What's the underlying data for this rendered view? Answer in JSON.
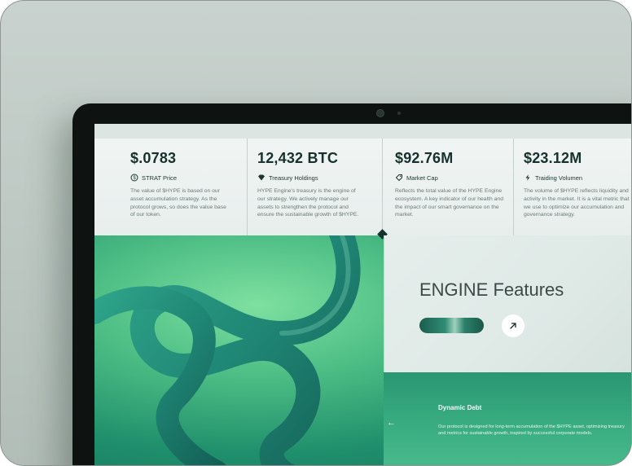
{
  "stats": [
    {
      "value": "$.0783",
      "label": "STRAT Price",
      "icon": "coin-icon",
      "desc": "The value of $HYPE is based on our asset accumulation strategy. As the protocol grows, so does the value base of our token."
    },
    {
      "value": "12,432 BTC",
      "label": "Treasury Holdings",
      "icon": "diamond-icon",
      "desc": "HYPE Engine's treasury is the engine of our strategy. We actively manage our assets to strengthen the protocol and ensure the sustainable growth of $HYPE."
    },
    {
      "value": "$92.76M",
      "label": "Market Cap",
      "icon": "tag-icon",
      "desc": "Reflects the total value of the HYPE Engine ecosystem. A key indicator of our health and the impact of our smart governance on the market."
    },
    {
      "value": "$23.12M",
      "label": "Traiding Volumen",
      "icon": "bolt-icon",
      "desc": "The volume of $HYPE reflects liquidity and activity in the market. It is a vital metric that we use to optimize our accumulation and governance strategy."
    }
  ],
  "feature": {
    "title": "ENGINE Features"
  },
  "slide": {
    "title": "Dynamic Debt",
    "desc": "Our protocol is designed for long-term accumulation of the $HYPE asset, optimizing treasury and metrics for sustainable growth, inspired by successful corporate models.",
    "prev_glyph": "←"
  },
  "colors": {
    "accent": "#12352e",
    "hero_green": "#4fbf86",
    "panel": "#e5eeeb"
  }
}
